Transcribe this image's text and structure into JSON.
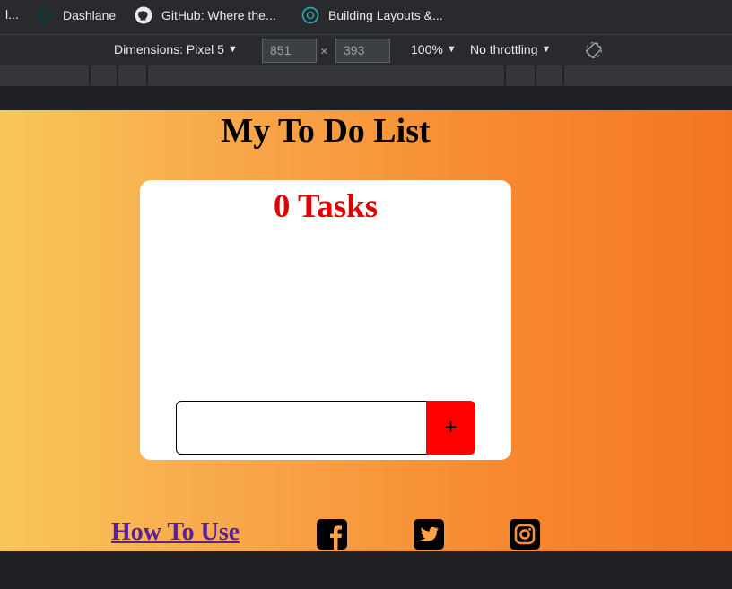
{
  "browser": {
    "bookmarks": [
      {
        "label": "l...",
        "icon": "none"
      },
      {
        "label": "Dashlane",
        "icon": "dashlane-icon"
      },
      {
        "label": "GitHub: Where the...",
        "icon": "github-icon"
      },
      {
        "label": "Building Layouts &...",
        "icon": "globe-icon"
      }
    ],
    "devtools": {
      "device_label": "Dimensions: Pixel 5",
      "width_value": "851",
      "height_value": "393",
      "times_symbol": "×",
      "zoom_label": "100%",
      "throttle_label": "No throttling",
      "dropdown_arrow": "▼"
    }
  },
  "page": {
    "title": "My To Do List",
    "task_count_label": "0 Tasks",
    "task_input": {
      "value": "",
      "placeholder": ""
    },
    "add_button_label": "+",
    "how_to_use_label": "How To Use",
    "social_icons": [
      "facebook-icon",
      "twitter-icon",
      "instagram-icon"
    ],
    "colors": {
      "gradient_start": "#f9c65a",
      "gradient_end": "#f47622",
      "task_count": "#e00000",
      "add_button": "#ff0000",
      "link": "#5a1fa0"
    }
  }
}
